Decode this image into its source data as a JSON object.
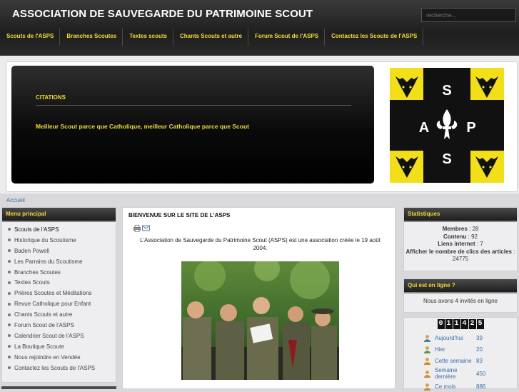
{
  "header": {
    "title": "ASSOCIATION DE SAUVEGARDE DU PATRIMOINE SCOUT",
    "search_placeholder": "recherche..."
  },
  "nav": [
    {
      "label": "Scouts de l'ASPS"
    },
    {
      "label": "Branches Scoutes"
    },
    {
      "label": "Textes scouts"
    },
    {
      "label": "Chants Scouts et autre"
    },
    {
      "label": "Forum Scout de l'ASPS"
    },
    {
      "label": "Contactez les Scouts de l'ASPS"
    }
  ],
  "banner": {
    "quote_title": "CITATIONS",
    "quote_text": "Meilleur Scout parce que Catholique, meilleur Catholique parce que Scout",
    "logo_letters": [
      "S",
      "A",
      "P",
      "S"
    ]
  },
  "breadcrumb": "Accueil",
  "left_menu": {
    "title": "Menu principal",
    "items": [
      "Scouts de l'ASPS",
      "Historique du Scoutisme",
      "Baden Powell",
      "Les Parrains du Scoutisme",
      "Branches Scoutes",
      "Textes Scouts",
      "Prières Scoutes et Méditations",
      "Revue Catholique pour Enfant",
      "Chants Scouts et autre",
      "Forum Scout de l'ASPS",
      "Calendrier Scout de l'ASPS",
      "La Boutique Scoute",
      "Nous rejoindre en Vendée",
      "Contactez les Scouts de l'ASPS"
    ]
  },
  "article": {
    "title": "BIENVENUE SUR LE SITE DE L'ASPS",
    "intro": "L'Association de Sauvegarde du Patrimoine Scout (ASPS) est  une association créée le 19 août 2004."
  },
  "stats": {
    "title": "Statistiques",
    "members_label": "Membres",
    "members_value": ": 28",
    "content_label": "Contenu",
    "content_value": ": 92",
    "links_label": "Liens internet",
    "links_value": ": 7",
    "clicks_label": "Afficher le nombre de clics des articles",
    "clicks_value": ": 24775"
  },
  "online": {
    "title": "Qui est en ligne ?",
    "text": "Nous avons 4 invités en ligne"
  },
  "counter": {
    "digits": [
      "0",
      "1",
      "1",
      "4",
      "2",
      "5"
    ],
    "rows": [
      {
        "label": "Aujourd'hui",
        "value": "39"
      },
      {
        "label": "Hier",
        "value": "20"
      },
      {
        "label": "Cette semaine",
        "value": "83"
      },
      {
        "label": "Semaine dernière",
        "value": "450"
      },
      {
        "label": "Ce mois",
        "value": "886"
      }
    ]
  }
}
